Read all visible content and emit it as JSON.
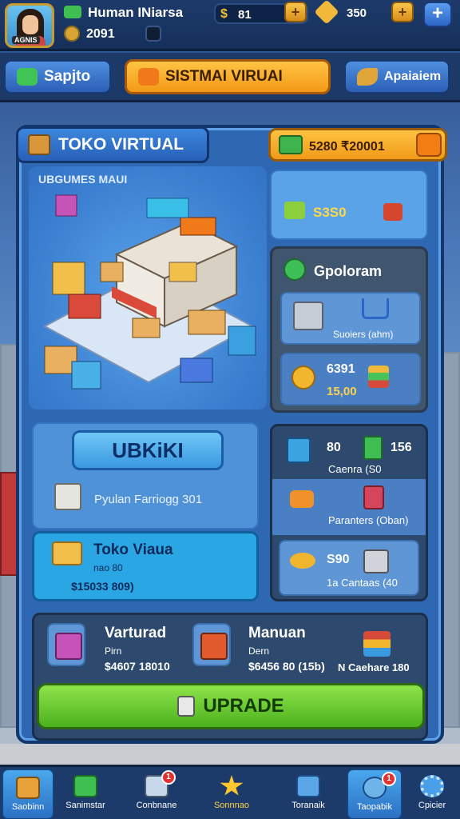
{
  "player": {
    "name": "Human INiarsa",
    "level": "2091",
    "avatar_tag": "AGNIS"
  },
  "resources": {
    "coins": "81",
    "gems": "350"
  },
  "tabs": {
    "left": "Sapjto",
    "center": "SISTMAI VIRUAI",
    "right": "Apaiaiem"
  },
  "panel": {
    "title": "TOKO VIRTUAL",
    "money": "5280 ₹20001",
    "store_label": "UBGUMES MAUI"
  },
  "stat_card": {
    "value": "S3S0"
  },
  "orders": {
    "title": "Gpoloram",
    "row1_text": "Suoiers (ahm)",
    "row2_value": "6391",
    "row2_sub": "15,00"
  },
  "main_card": {
    "button": "UBKiKI",
    "desc": "Pyulan Farriogg 301"
  },
  "toko_card": {
    "title": "Toko Viaua",
    "sub": "nao 80",
    "price": "$15033 809)"
  },
  "upgrades": {
    "row1_val1": "80",
    "row1_val2": "156",
    "row1_sub": "Caenra (S0",
    "row2_sub": "Paranters (Oban)",
    "row3_val": "S90",
    "row3_sub": "1a Cantaas (40"
  },
  "items": [
    {
      "title": "Varturad",
      "sub": "Pirn",
      "price": "$4607 18010"
    },
    {
      "title": "Manuan",
      "sub": "Dern",
      "price": "$6456 80 (15b)"
    },
    {
      "price": "N Caehare 180"
    }
  ],
  "upgrade_button": "UPRADE",
  "bottom_nav": [
    {
      "label": "Saobinn"
    },
    {
      "label": "Sanimstar"
    },
    {
      "label": "Conbnane",
      "badge": "1"
    },
    {
      "label": "Sonnnao"
    },
    {
      "label": "Toranaik"
    },
    {
      "label": "Taopabik",
      "badge": "1"
    },
    {
      "label": "Cpicier"
    }
  ],
  "colors": {
    "accent_orange": "#f29a16",
    "accent_green": "#4cb21e",
    "panel_blue": "#2e67b2"
  }
}
